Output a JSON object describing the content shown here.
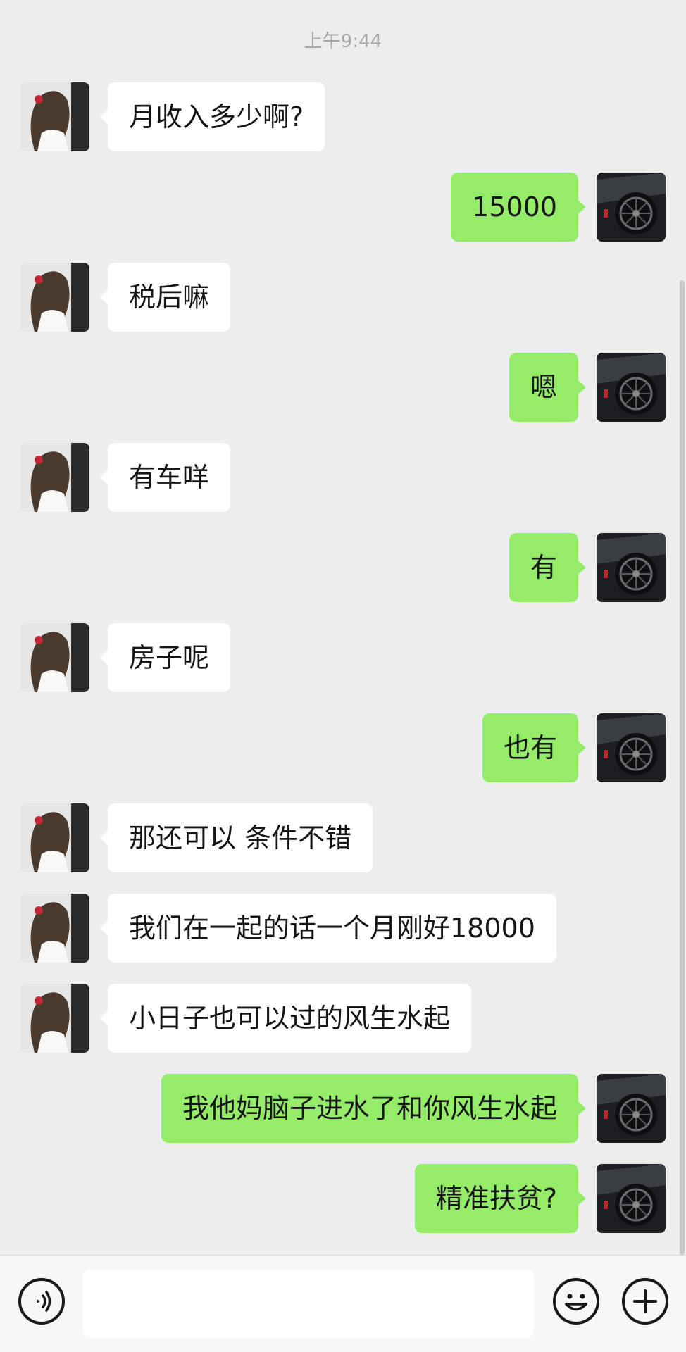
{
  "chat": {
    "timestamp": "上午9:44",
    "messages": [
      {
        "from": "her",
        "text": "月收入多少啊?"
      },
      {
        "from": "me",
        "text": "15000"
      },
      {
        "from": "her",
        "text": "税后嘛"
      },
      {
        "from": "me",
        "text": "嗯"
      },
      {
        "from": "her",
        "text": "有车咩"
      },
      {
        "from": "me",
        "text": "有"
      },
      {
        "from": "her",
        "text": "房子呢"
      },
      {
        "from": "me",
        "text": "也有"
      },
      {
        "from": "her",
        "text": "那还可以 条件不错"
      },
      {
        "from": "her",
        "text": "我们在一起的话一个月刚好18000"
      },
      {
        "from": "her",
        "text": "小日子也可以过的风生水起"
      },
      {
        "from": "me",
        "text": "我他妈脑子进水了和你风生水起"
      },
      {
        "from": "me",
        "text": "精准扶贫?"
      }
    ]
  },
  "input_bar": {
    "message_value": "",
    "icons": [
      "voice-icon",
      "emoji-icon",
      "plus-icon"
    ]
  },
  "colors": {
    "background": "#ededed",
    "incoming_bubble": "#ffffff",
    "outgoing_bubble": "#95ec69",
    "timestamp_text": "#a8a8a8"
  }
}
